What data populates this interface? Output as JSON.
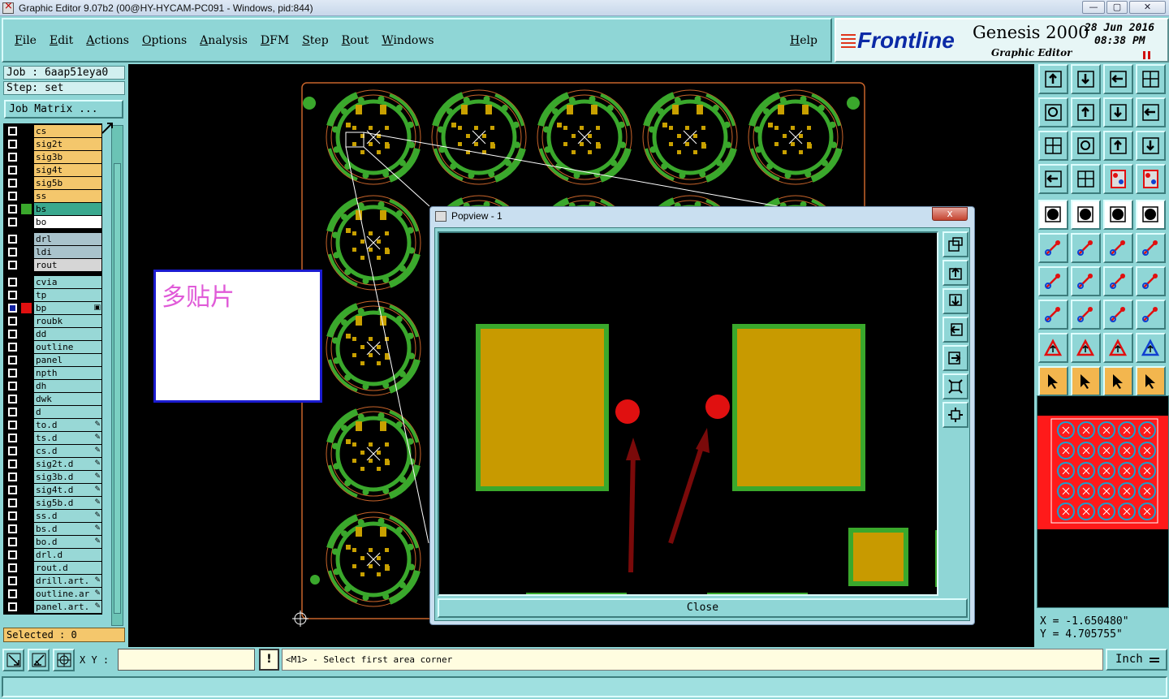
{
  "window": {
    "title": "Graphic Editor 9.07b2 (00@HY-HYCAM-PC091 - Windows, pid:844)",
    "minimize": "—",
    "maximize": "▢",
    "close": "✕"
  },
  "menu": {
    "items": [
      "File",
      "Edit",
      "Actions",
      "Options",
      "Analysis",
      "DFM",
      "Step",
      "Rout",
      "Windows"
    ],
    "help": "Help"
  },
  "logo": {
    "brand": "Frontline",
    "product": "Genesis 2000",
    "subtitle": "Graphic Editor",
    "date": "28 Jun 2016",
    "time": "08:38 PM"
  },
  "left": {
    "job": "Job : 6aap51eya0",
    "step": "Step: set",
    "job_matrix": "Job Matrix ...",
    "selected": "Selected : 0",
    "layers": [
      {
        "name": "cs",
        "style": "board"
      },
      {
        "name": "sig2t",
        "style": "board"
      },
      {
        "name": "sig3b",
        "style": "board"
      },
      {
        "name": "sig4t",
        "style": "board"
      },
      {
        "name": "sig5b",
        "style": "board"
      },
      {
        "name": "ss",
        "style": "board"
      },
      {
        "name": "bs",
        "style": "selbs",
        "color": "#3aa82c"
      },
      {
        "name": "bo",
        "style": "white"
      },
      {
        "name": "drl",
        "style": "drill",
        "gap": true
      },
      {
        "name": "ldi",
        "style": "drill"
      },
      {
        "name": "rout",
        "style": "rout"
      },
      {
        "name": "cvia",
        "style": "misc",
        "gap": true
      },
      {
        "name": "tp",
        "style": "misc"
      },
      {
        "name": "bp",
        "style": "misc",
        "color": "#e01010",
        "marker": "▣",
        "active": true
      },
      {
        "name": "roubk",
        "style": "misc"
      },
      {
        "name": "dd",
        "style": "misc"
      },
      {
        "name": "outline",
        "style": "misc"
      },
      {
        "name": "panel",
        "style": "misc"
      },
      {
        "name": "npth",
        "style": "misc"
      },
      {
        "name": "dh",
        "style": "misc"
      },
      {
        "name": "dwk",
        "style": "misc"
      },
      {
        "name": "d",
        "style": "misc"
      },
      {
        "name": "to.d",
        "style": "misc",
        "marker": "✎"
      },
      {
        "name": "ts.d",
        "style": "misc",
        "marker": "✎"
      },
      {
        "name": "cs.d",
        "style": "misc",
        "marker": "✎"
      },
      {
        "name": "sig2t.d",
        "style": "misc",
        "marker": "✎"
      },
      {
        "name": "sig3b.d",
        "style": "misc",
        "marker": "✎"
      },
      {
        "name": "sig4t.d",
        "style": "misc",
        "marker": "✎"
      },
      {
        "name": "sig5b.d",
        "style": "misc",
        "marker": "✎"
      },
      {
        "name": "ss.d",
        "style": "misc",
        "marker": "✎"
      },
      {
        "name": "bs.d",
        "style": "misc",
        "marker": "✎"
      },
      {
        "name": "bo.d",
        "style": "misc",
        "marker": "✎"
      },
      {
        "name": "drl.d",
        "style": "misc"
      },
      {
        "name": "rout.d",
        "style": "misc"
      },
      {
        "name": "drill.art.",
        "style": "misc",
        "marker": "✎"
      },
      {
        "name": "outline.ar",
        "style": "misc",
        "marker": "✎"
      },
      {
        "name": "panel.art.",
        "style": "misc",
        "marker": "✎"
      }
    ]
  },
  "note": {
    "text": "多贴片"
  },
  "popview": {
    "title": "Popview - 1",
    "close_x": "x",
    "close_label": "Close"
  },
  "coords": {
    "x": "X = -1.650480\"",
    "y": "Y = 4.705755\""
  },
  "bottom": {
    "xy_label": "X Y :",
    "xy_value": "",
    "warn": "!",
    "prompt": "<M1> - Select first area corner",
    "unit": "Inch"
  },
  "colors": {
    "board_outline": "#c8642a",
    "copper": "#c8a000",
    "pad_border": "#3aa82c",
    "marker_red": "#e01010",
    "arrow": "#7a0a0a",
    "bg_teal": "#8fd6d6"
  }
}
